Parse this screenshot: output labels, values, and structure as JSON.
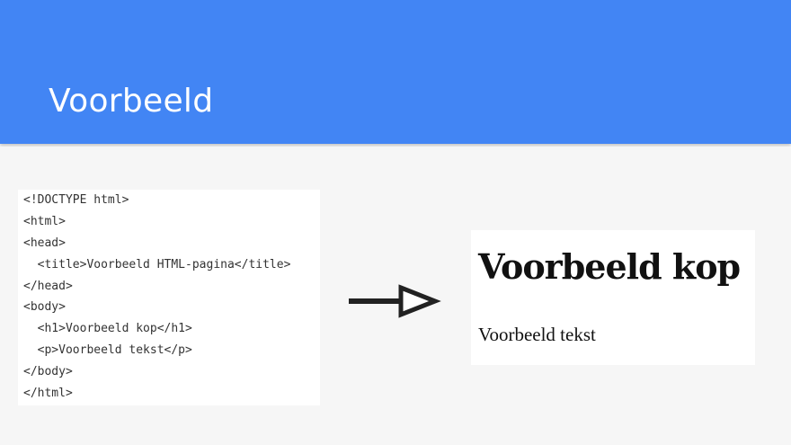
{
  "slide": {
    "title": "Voorbeeld"
  },
  "code": {
    "lines": [
      "<!DOCTYPE html>",
      "<html>",
      "<head>",
      "  <title>Voorbeeld HTML-pagina</title>",
      "</head>",
      "<body>",
      "  <h1>Voorbeeld kop</h1>",
      "  <p>Voorbeeld tekst</p>",
      "</body>",
      "</html>"
    ]
  },
  "preview": {
    "heading": "Voorbeeld kop",
    "text": "Voorbeeld tekst"
  },
  "icons": {
    "arrow": "right-arrow-icon"
  },
  "colors": {
    "header_bg": "#4285f4"
  }
}
